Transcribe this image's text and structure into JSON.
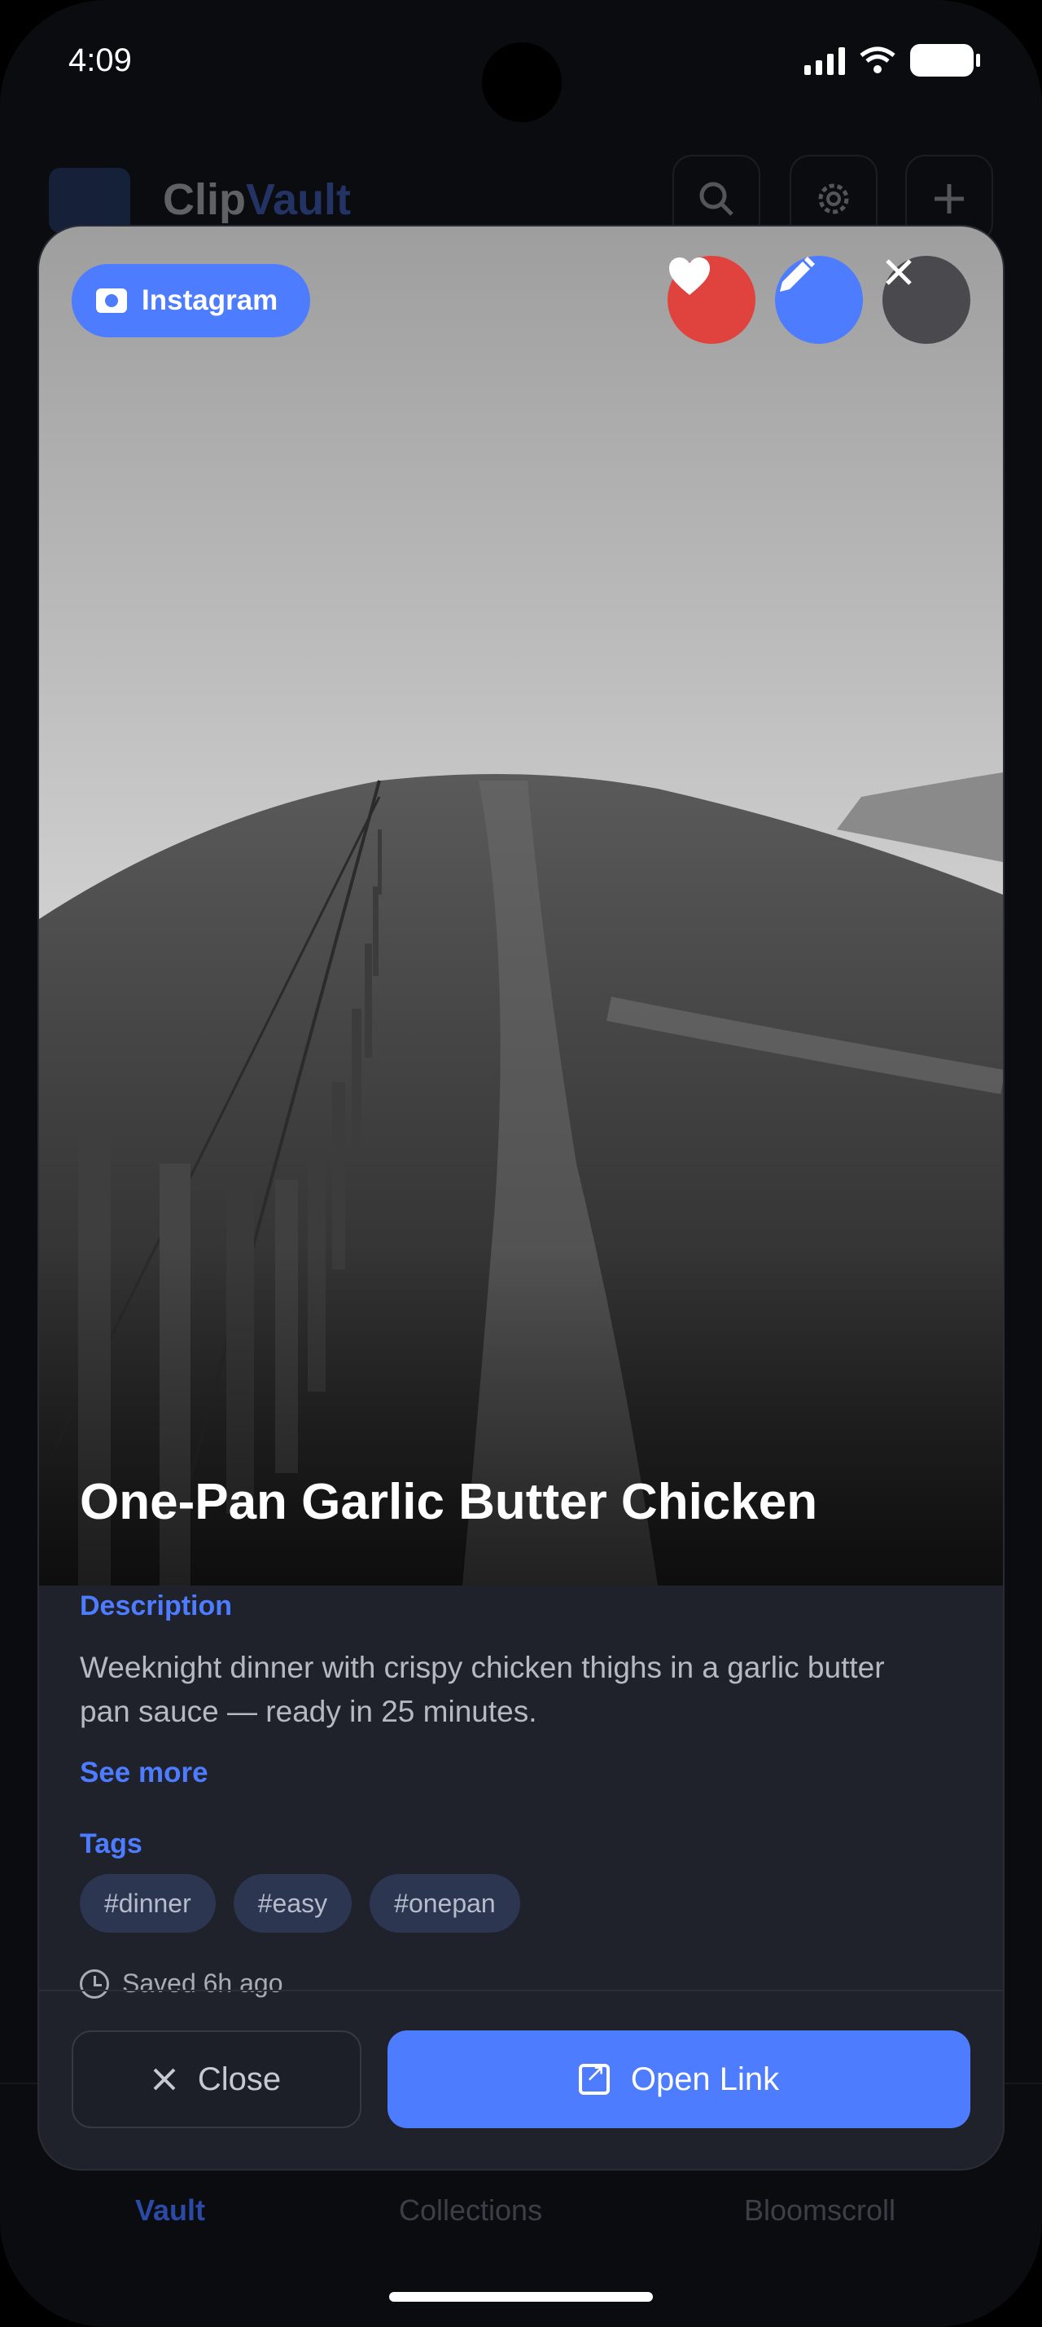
{
  "status_bar": {
    "time": "4:09"
  },
  "app_header": {
    "title_part1": "Clip",
    "title_part2": "Vault"
  },
  "modal": {
    "platform": "Instagram",
    "title": "One-Pan Garlic Butter Chicken",
    "description_label": "Description",
    "description": "Weeknight dinner with crispy chicken thighs in a garlic butter pan sauce — ready in 25 minutes.",
    "see_more": "See more",
    "tags_label": "Tags",
    "tags": [
      "#dinner",
      "#easy",
      "#onepan"
    ],
    "saved": "Saved 6h ago",
    "close_label": "Close",
    "open_label": "Open Link",
    "accent_color": "#4d7cff",
    "favorite_color": "#e0433e"
  },
  "bottom_nav": {
    "items": [
      "Vault",
      "Collections",
      "Bloomscroll"
    ],
    "active": "Vault"
  },
  "icons": [
    "camera-icon",
    "heart-icon",
    "pencil-icon",
    "close-icon",
    "search-icon",
    "gear-icon",
    "plus-icon",
    "clock-icon",
    "external-link-icon"
  ]
}
